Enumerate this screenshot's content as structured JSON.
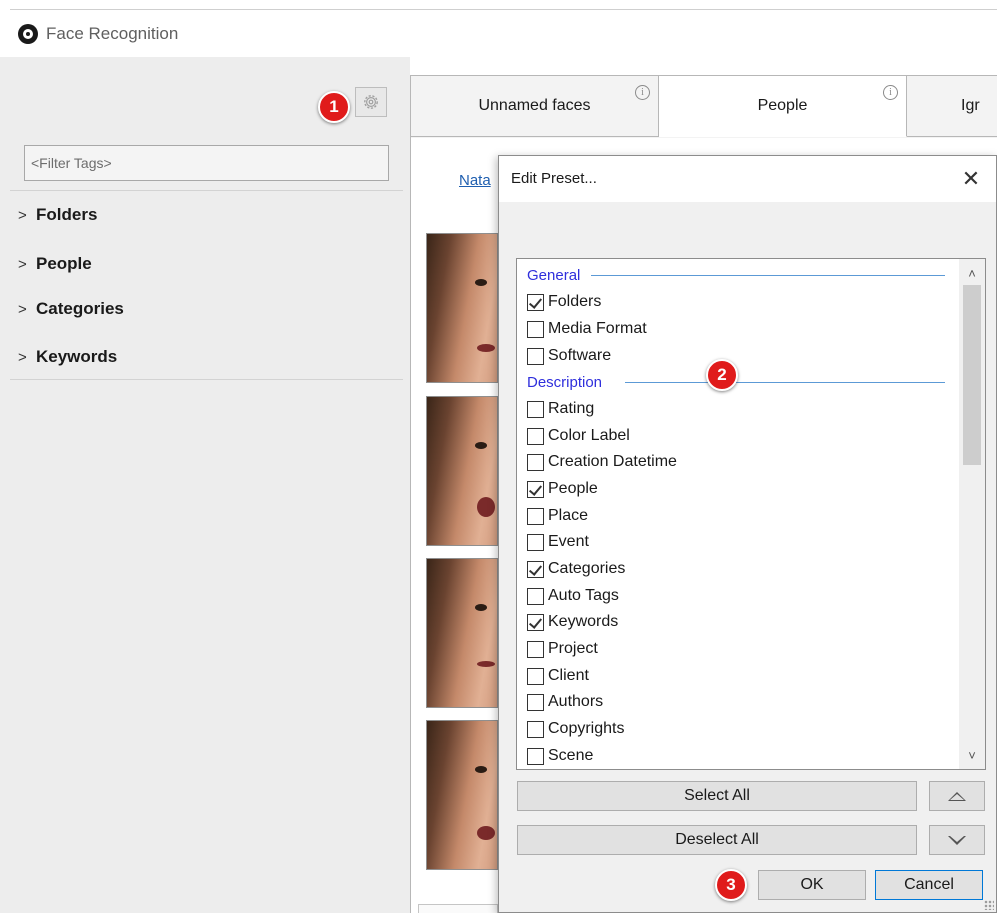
{
  "window": {
    "title": "Face Recognition"
  },
  "sidebar": {
    "filter_placeholder": "<Filter Tags>",
    "items": [
      {
        "label": "Folders"
      },
      {
        "label": "People"
      },
      {
        "label": "Categories"
      },
      {
        "label": "Keywords"
      }
    ]
  },
  "tabs": [
    {
      "label": "Unnamed faces",
      "info": "i"
    },
    {
      "label": "People",
      "info": "i"
    },
    {
      "label": "Igr"
    }
  ],
  "people_view": {
    "person_link": "Nata"
  },
  "dialog": {
    "title": "Edit Preset...",
    "close_glyph": "✕",
    "groups": [
      {
        "name": "General",
        "items": [
          {
            "label": "Folders",
            "checked": true
          },
          {
            "label": "Media Format",
            "checked": false
          },
          {
            "label": "Software",
            "checked": false
          }
        ]
      },
      {
        "name": "Description",
        "items": [
          {
            "label": "Rating",
            "checked": false
          },
          {
            "label": "Color Label",
            "checked": false
          },
          {
            "label": "Creation Datetime",
            "checked": false
          },
          {
            "label": "People",
            "checked": true
          },
          {
            "label": "Place",
            "checked": false
          },
          {
            "label": "Event",
            "checked": false
          },
          {
            "label": "Categories",
            "checked": true
          },
          {
            "label": "Auto Tags",
            "checked": false
          },
          {
            "label": "Keywords",
            "checked": true
          },
          {
            "label": "Project",
            "checked": false
          },
          {
            "label": "Client",
            "checked": false
          },
          {
            "label": "Authors",
            "checked": false
          },
          {
            "label": "Copyrights",
            "checked": false
          },
          {
            "label": "Scene",
            "checked": false
          }
        ]
      }
    ],
    "select_all_label": "Select All",
    "deselect_all_label": "Deselect All",
    "ok_label": "OK",
    "cancel_label": "Cancel",
    "scroll_up_glyph": "˄",
    "scroll_down_glyph": "˅"
  },
  "annotations": {
    "step1": "1",
    "step2": "2",
    "step3": "3",
    "badge_color": "#e01b1b"
  },
  "colors": {
    "group_header": "#2f2fdc",
    "group_line": "#5c9ad6",
    "link": "#1f5fb0",
    "primary_border": "#0078d7"
  }
}
